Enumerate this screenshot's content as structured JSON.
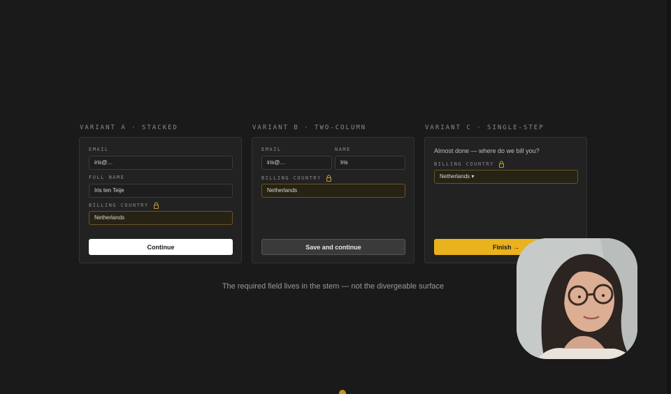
{
  "variants": [
    {
      "label": "VARIANT A · STACKED",
      "fields": [
        {
          "label": "EMAIL",
          "value": "iris@…"
        },
        {
          "label": "FULL NAME",
          "value": "Iris ten Teije"
        },
        {
          "label": "BILLING COUNTRY",
          "value": "Netherlands",
          "locked": true
        }
      ],
      "button": "Continue"
    },
    {
      "label": "VARIANT B · TWO-COLUMN",
      "fields": [
        {
          "label": "EMAIL",
          "value": "iris@…"
        },
        {
          "label": "NAME",
          "value": "Iris"
        },
        {
          "label": "BILLING COUNTRY",
          "value": "Netherlands",
          "locked": true
        }
      ],
      "button": "Save and continue"
    },
    {
      "label": "VARIANT C · SINGLE-STEP",
      "question": "Almost done — where do we bill you?",
      "fields": [
        {
          "label": "BILLING COUNTRY",
          "value": "Netherlands ▾",
          "locked": true
        }
      ],
      "button": "Finish →"
    }
  ],
  "caption": "The required field lives in the stem — not the divergeable surface",
  "colors": {
    "background": "#1a1a1a",
    "card": "#222222",
    "accent": "#eab21c",
    "highlight_border": "#6a5622"
  },
  "icons": [
    "lock-icon",
    "webcam-presenter"
  ]
}
